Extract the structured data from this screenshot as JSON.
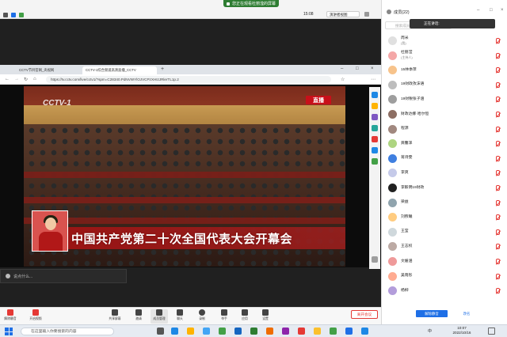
{
  "meeting": {
    "sharing_banner": "您正在观看杜丽滢的屏幕",
    "time": "15:08",
    "view_mode": "演讲者视图"
  },
  "browser": {
    "tabs": [
      {
        "label": "CCTV节目官网_央视网"
      },
      {
        "label": "CCTV-1综合频道高清直播_CCTV"
      }
    ],
    "url": "https://tv.cctv.com/live/cctv1/?spm=C28340.PdNVWYlOJVCPzXHIzJRlerTL1p.2"
  },
  "video": {
    "channel_logo": "CCTV-1",
    "live_badge": "直播",
    "caption": "中国共产党第二十次全国代表大会开幕会"
  },
  "chat": {
    "placeholder": "说点什么..."
  },
  "toolbar": {
    "buttons": [
      {
        "label": "解除静音"
      },
      {
        "label": "开启视频"
      },
      {
        "label": "共享屏幕"
      },
      {
        "label": "邀请"
      },
      {
        "label": "成员管理"
      },
      {
        "label": "聊天"
      },
      {
        "label": "录制"
      },
      {
        "label": "举手"
      },
      {
        "label": "应用"
      },
      {
        "label": "设置"
      }
    ],
    "end_label": "离开会议"
  },
  "participants_panel": {
    "title": "成员(22)",
    "search_placeholder": "搜索成员",
    "speaking_label": "正在讲话:",
    "mute_all_label": "解除静音",
    "rename_label": "改名",
    "members": [
      {
        "name": "周米",
        "sub": "(我)",
        "color": "#e0e0e0"
      },
      {
        "name": "杜丽滢",
        "sub": "(主持人)",
        "color": "#f4a7a7"
      },
      {
        "name": "15林季萍",
        "sub": "",
        "color": "#f7c38b"
      },
      {
        "name": "19财政孜沫语",
        "sub": "",
        "color": "#bdbdbd"
      },
      {
        "name": "19财税张子涵",
        "sub": "",
        "color": "#9e9e9e"
      },
      {
        "name": "财政达娜·哈尔恒",
        "sub": "",
        "color": "#8d6e63"
      },
      {
        "name": "程源",
        "sub": "",
        "color": "#a1887f"
      },
      {
        "name": "龚馨泽",
        "sub": "",
        "color": "#aed581"
      },
      {
        "name": "蒋诗雯",
        "sub": "",
        "color": "#3f7fe0"
      },
      {
        "name": "李爽",
        "sub": "",
        "color": "#c5cae9"
      },
      {
        "name": "李毅明19财政",
        "sub": "",
        "color": "#212121"
      },
      {
        "name": "梁益",
        "sub": "",
        "color": "#90a4ae"
      },
      {
        "name": "刘煦曦",
        "sub": "",
        "color": "#ffcc80"
      },
      {
        "name": "王莹",
        "sub": "",
        "color": "#cfd8dc"
      },
      {
        "name": "王志权",
        "sub": "",
        "color": "#bcaaa4"
      },
      {
        "name": "文媛涵",
        "sub": "",
        "color": "#ef9a9a"
      },
      {
        "name": "吴雨彤",
        "sub": "",
        "color": "#ffab91"
      },
      {
        "name": "杨柳",
        "sub": "",
        "color": "#b39ddb"
      }
    ]
  },
  "taskbar": {
    "search_placeholder": "在这里输入你要搜索的内容",
    "time": "10:07",
    "date": "2022/10/16",
    "ime": "中"
  }
}
